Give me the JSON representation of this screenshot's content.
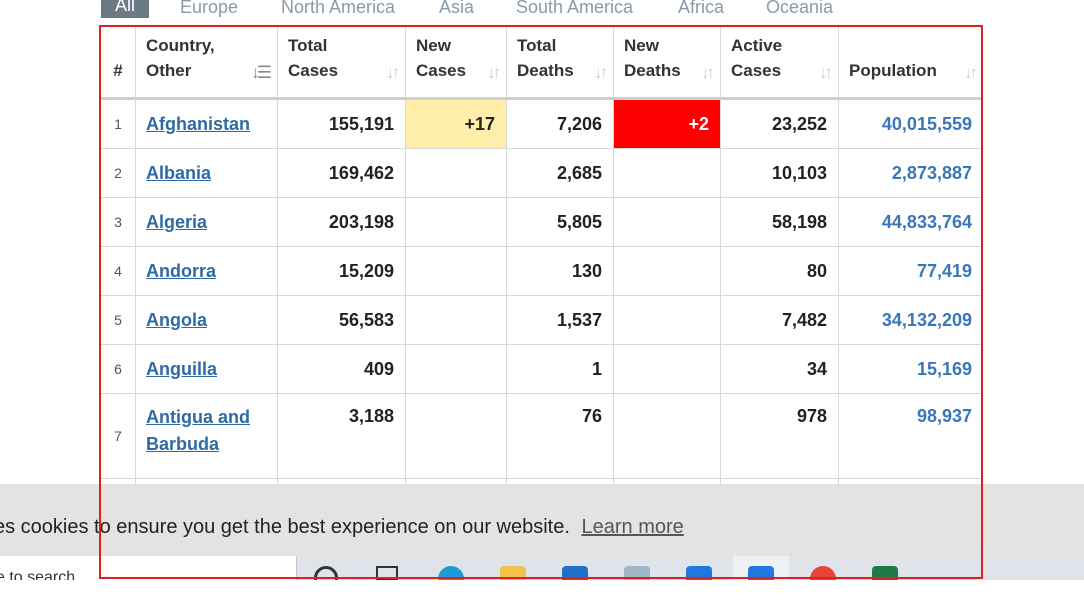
{
  "tabs": [
    "All",
    "Europe",
    "North America",
    "Asia",
    "South America",
    "Africa",
    "Oceania"
  ],
  "table": {
    "headers": {
      "idx": "#",
      "country_1": "Country,",
      "country_2": "Other",
      "total_cases_1": "Total",
      "total_cases_2": "Cases",
      "new_cases_1": "New",
      "new_cases_2": "Cases",
      "total_deaths_1": "Total",
      "total_deaths_2": "Deaths",
      "new_deaths_1": "New",
      "new_deaths_2": "Deaths",
      "active_cases_1": "Active",
      "active_cases_2": "Cases",
      "population": "Population"
    },
    "rows": [
      {
        "idx": "1",
        "country": "Afghanistan",
        "total_cases": "155,191",
        "new_cases": "+17",
        "total_deaths": "7,206",
        "new_deaths": "+2",
        "active_cases": "23,252",
        "population": "40,015,559"
      },
      {
        "idx": "2",
        "country": "Albania",
        "total_cases": "169,462",
        "new_cases": "",
        "total_deaths": "2,685",
        "new_deaths": "",
        "active_cases": "10,103",
        "population": "2,873,887"
      },
      {
        "idx": "3",
        "country": "Algeria",
        "total_cases": "203,198",
        "new_cases": "",
        "total_deaths": "5,805",
        "new_deaths": "",
        "active_cases": "58,198",
        "population": "44,833,764"
      },
      {
        "idx": "4",
        "country": "Andorra",
        "total_cases": "15,209",
        "new_cases": "",
        "total_deaths": "130",
        "new_deaths": "",
        "active_cases": "80",
        "population": "77,419"
      },
      {
        "idx": "5",
        "country": "Angola",
        "total_cases": "56,583",
        "new_cases": "",
        "total_deaths": "1,537",
        "new_deaths": "",
        "active_cases": "7,482",
        "population": "34,132,209"
      },
      {
        "idx": "6",
        "country": "Anguilla",
        "total_cases": "409",
        "new_cases": "",
        "total_deaths": "1",
        "new_deaths": "",
        "active_cases": "34",
        "population": "15,169"
      },
      {
        "idx": "7",
        "country_1": "Antigua and",
        "country_2": "Barbuda",
        "total_cases": "3,188",
        "new_cases": "",
        "total_deaths": "76",
        "new_deaths": "",
        "active_cases": "978",
        "population": "98,937"
      }
    ]
  },
  "cookie_bar": {
    "message": "es cookies to ensure you get the best experience on our website.",
    "learn_more": "Learn more"
  },
  "taskbar": {
    "search_placeholder": "e to search"
  },
  "colors": {
    "new_cases_highlight": "#ffeeaa",
    "new_deaths_highlight": "#ff0000",
    "link": "#2e6aa6",
    "population": "#3a77b8",
    "annotation_box": "#e02020"
  }
}
